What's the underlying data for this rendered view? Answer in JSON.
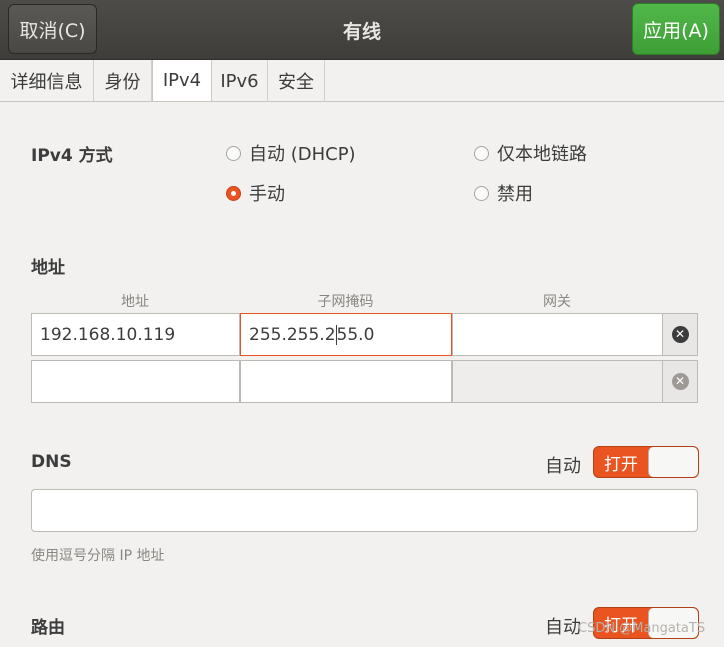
{
  "header": {
    "cancel_label": "取消(C)",
    "title": "有线",
    "apply_label": "应用(A)"
  },
  "tabs": [
    {
      "label": "详细信息"
    },
    {
      "label": "身份"
    },
    {
      "label": "IPv4"
    },
    {
      "label": "IPv6"
    },
    {
      "label": "安全"
    }
  ],
  "ipv4_method": {
    "label": "IPv4 方式",
    "options": [
      {
        "label": "自动 (DHCP)",
        "checked": false
      },
      {
        "label": "仅本地链路",
        "checked": false
      },
      {
        "label": "手动",
        "checked": true
      },
      {
        "label": "禁用",
        "checked": false
      }
    ]
  },
  "addresses": {
    "section_label": "地址",
    "columns": [
      "地址",
      "子网掩码",
      "网关"
    ],
    "rows": [
      {
        "address": "192.168.10.119",
        "netmask_before_caret": "255.255.2",
        "netmask_after_caret": "55.0",
        "gateway": ""
      },
      {
        "address": "",
        "netmask": "",
        "gateway": ""
      }
    ]
  },
  "dns": {
    "label": "DNS",
    "auto_label": "自动",
    "toggle_label": "打开",
    "toggle_on": true,
    "value": "",
    "hint": "使用逗号分隔 IP 地址"
  },
  "routes": {
    "label": "路由",
    "auto_label": "自动",
    "toggle_label": "打开",
    "toggle_on": true
  },
  "watermark": "CSDN @MangataTS",
  "colors": {
    "accent": "#e95420",
    "apply_green": "#3d9e36",
    "headerbar": "#3f3d3a"
  }
}
